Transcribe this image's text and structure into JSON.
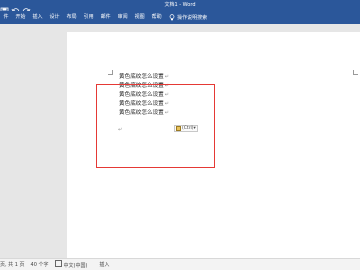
{
  "titlebar": {
    "title": "文档1 - Word",
    "quick_access": [
      "save-icon",
      "undo-icon",
      "redo-icon",
      "customize-icon"
    ],
    "background_color": "#2b579a"
  },
  "ribbon": {
    "tabs": [
      "件",
      "开始",
      "插入",
      "设计",
      "布局",
      "引用",
      "邮件",
      "审阅",
      "视图",
      "帮助"
    ],
    "tell_me": "操作说明搜索"
  },
  "document": {
    "lines": [
      "黄色底纹怎么设置",
      "黄色底纹怎么设置",
      "黄色底纹怎么设置",
      "黄色底纹怎么设置",
      "黄色底纹怎么设置"
    ],
    "paragraph_mark": "↵",
    "paste_options_label": "(Ctrl)",
    "highlight_color": "#e53935"
  },
  "statusbar": {
    "page_info": "页, 共 1 页",
    "word_count": "40 个字",
    "language": "中文(中国)",
    "mode": "插入"
  }
}
